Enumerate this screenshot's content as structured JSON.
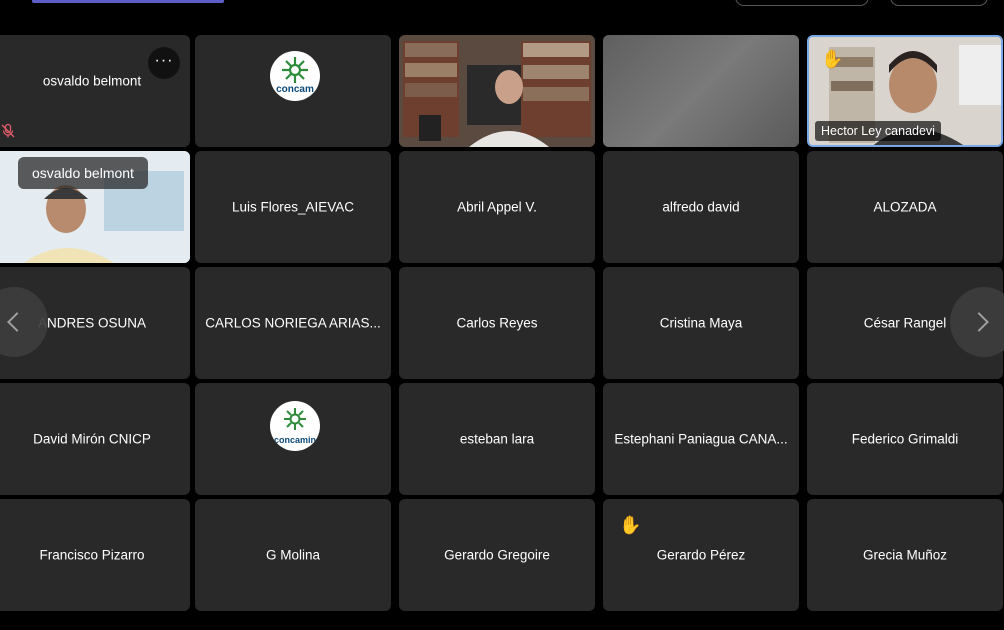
{
  "tiles": {
    "r0c0": {
      "name": "osvaldo belmont"
    },
    "r0c4": {
      "name": "Hector Ley canadevi"
    },
    "r1c0": {
      "name": "osvaldo belmont"
    },
    "r1c1": {
      "name": "Luis Flores_AIEVAC"
    },
    "r1c2": {
      "name": "Abril Appel V."
    },
    "r1c3": {
      "name": "alfredo david"
    },
    "r1c4": {
      "name": "ALOZADA"
    },
    "r2c0": {
      "name": "ANDRES OSUNA"
    },
    "r2c1": {
      "name": "CARLOS NORIEGA ARIAS..."
    },
    "r2c2": {
      "name": "Carlos Reyes"
    },
    "r2c3": {
      "name": "Cristina Maya"
    },
    "r2c4": {
      "name": "César Rangel"
    },
    "r3c0": {
      "name": "David Mirón CNICP"
    },
    "r3c2": {
      "name": "esteban lara"
    },
    "r3c3": {
      "name": "Estephani Paniagua CANA..."
    },
    "r3c4": {
      "name": "Federico Grimaldi"
    },
    "r4c0": {
      "name": "Francisco Pizarro"
    },
    "r4c1": {
      "name": "G Molina"
    },
    "r4c2": {
      "name": "Gerardo Gregoire"
    },
    "r4c3": {
      "name": "Gerardo Pérez"
    },
    "r4c4": {
      "name": "Grecia Muñoz"
    }
  },
  "logos": {
    "concamin_a": "concam",
    "concamin_b": "concamin"
  },
  "icons": {
    "more": "more-options-icon",
    "mic_off": "mic-off-icon",
    "hand": "raised-hand-icon",
    "prev": "chevron-left-icon",
    "next": "chevron-right-icon"
  },
  "glyphs": {
    "more": "···",
    "hand": "✋"
  },
  "colors": {
    "tile_bg": "#292929",
    "active_border": "#7aa7e6",
    "accent": "#5b5fc7",
    "hand": "#f5b800"
  }
}
